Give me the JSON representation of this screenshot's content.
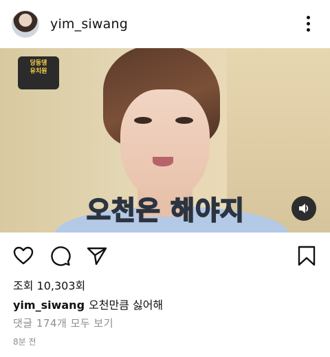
{
  "post": {
    "username": "yim_siwang",
    "caption_overlay_highlight": "오천",
    "caption_overlay_rest": "은 해야지",
    "show_logo_text": "",
    "views_label": "조회",
    "views_count": "10,303회",
    "caption_user": "yim_siwang",
    "caption_text": "오천만큼 싫어해",
    "comments_link": "댓글 174개 모두 보기",
    "time_ago": "8분 전"
  },
  "icons": {
    "more": "more-vertical-icon",
    "like": "heart-icon",
    "comment": "comment-icon",
    "share": "send-icon",
    "save": "bookmark-icon",
    "sound": "speaker-icon"
  }
}
